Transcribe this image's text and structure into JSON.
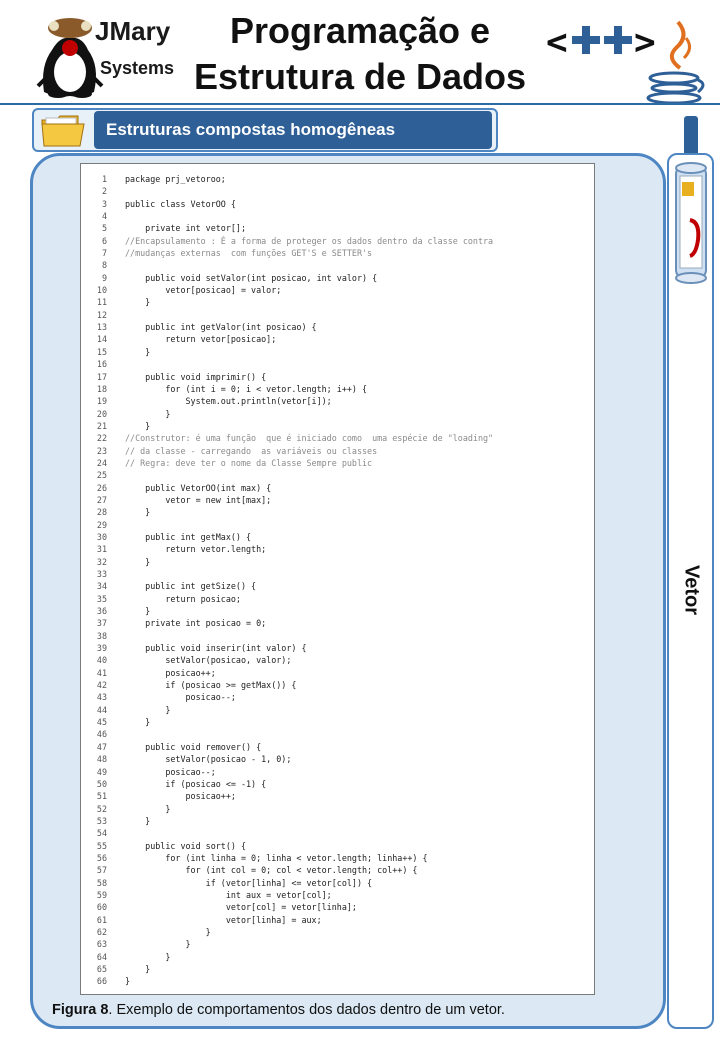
{
  "header": {
    "logo_line1": "JMary",
    "logo_line2": "Systems",
    "title": "Programação e Estrutura de Dados",
    "cpp_label": "<++>",
    "java_icon": "java-cup-icon"
  },
  "section": {
    "label": "Estruturas compostas homogêneas",
    "folder_icon": "folder-icon"
  },
  "side_tab": {
    "label": "Vetor",
    "icon": "scroll-icon"
  },
  "code": {
    "lines": [
      "package prj_vetoroo;",
      "",
      "public class VetorOO {",
      "",
      "    private int vetor[];",
      "//Encapsulamento : É a forma de proteger os dados dentro da classe contra",
      "//mudanças externas  com funções GET'S e SETTER's",
      "",
      "    public void setValor(int posicao, int valor) {",
      "        vetor[posicao] = valor;",
      "    }",
      "",
      "    public int getValor(int posicao) {",
      "        return vetor[posicao];",
      "    }",
      "",
      "    public void imprimir() {",
      "        for (int i = 0; i < vetor.length; i++) {",
      "            System.out.println(vetor[i]);",
      "        }",
      "    }",
      "//Construtor: é uma função  que é iniciado como  uma espécie de \"loading\"",
      "// da classe - carregando  as variáveis ou classes",
      "// Regra: deve ter o nome da Classe Sempre public",
      "",
      "    public VetorOO(int max) {",
      "        vetor = new int[max];",
      "    }",
      "",
      "    public int getMax() {",
      "        return vetor.length;",
      "    }",
      "",
      "    public int getSize() {",
      "        return posicao;",
      "    }",
      "    private int posicao = 0;",
      "",
      "    public void inserir(int valor) {",
      "        setValor(posicao, valor);",
      "        posicao++;",
      "        if (posicao >= getMax()) {",
      "            posicao--;",
      "        }",
      "    }",
      "",
      "    public void remover() {",
      "        setValor(posicao - 1, 0);",
      "        posicao--;",
      "        if (posicao <= -1) {",
      "            posicao++;",
      "        }",
      "    }",
      "",
      "    public void sort() {",
      "        for (int linha = 0; linha < vetor.length; linha++) {",
      "            for (int col = 0; col < vetor.length; col++) {",
      "                if (vetor[linha] <= vetor[col]) {",
      "                    int aux = vetor[col];",
      "                    vetor[col] = vetor[linha];",
      "                    vetor[linha] = aux;",
      "                }",
      "            }",
      "        }",
      "    }",
      "}"
    ]
  },
  "caption": {
    "label": "Figura 8",
    "text": ". Exemplo de comportamentos dos dados dentro de um vetor."
  }
}
